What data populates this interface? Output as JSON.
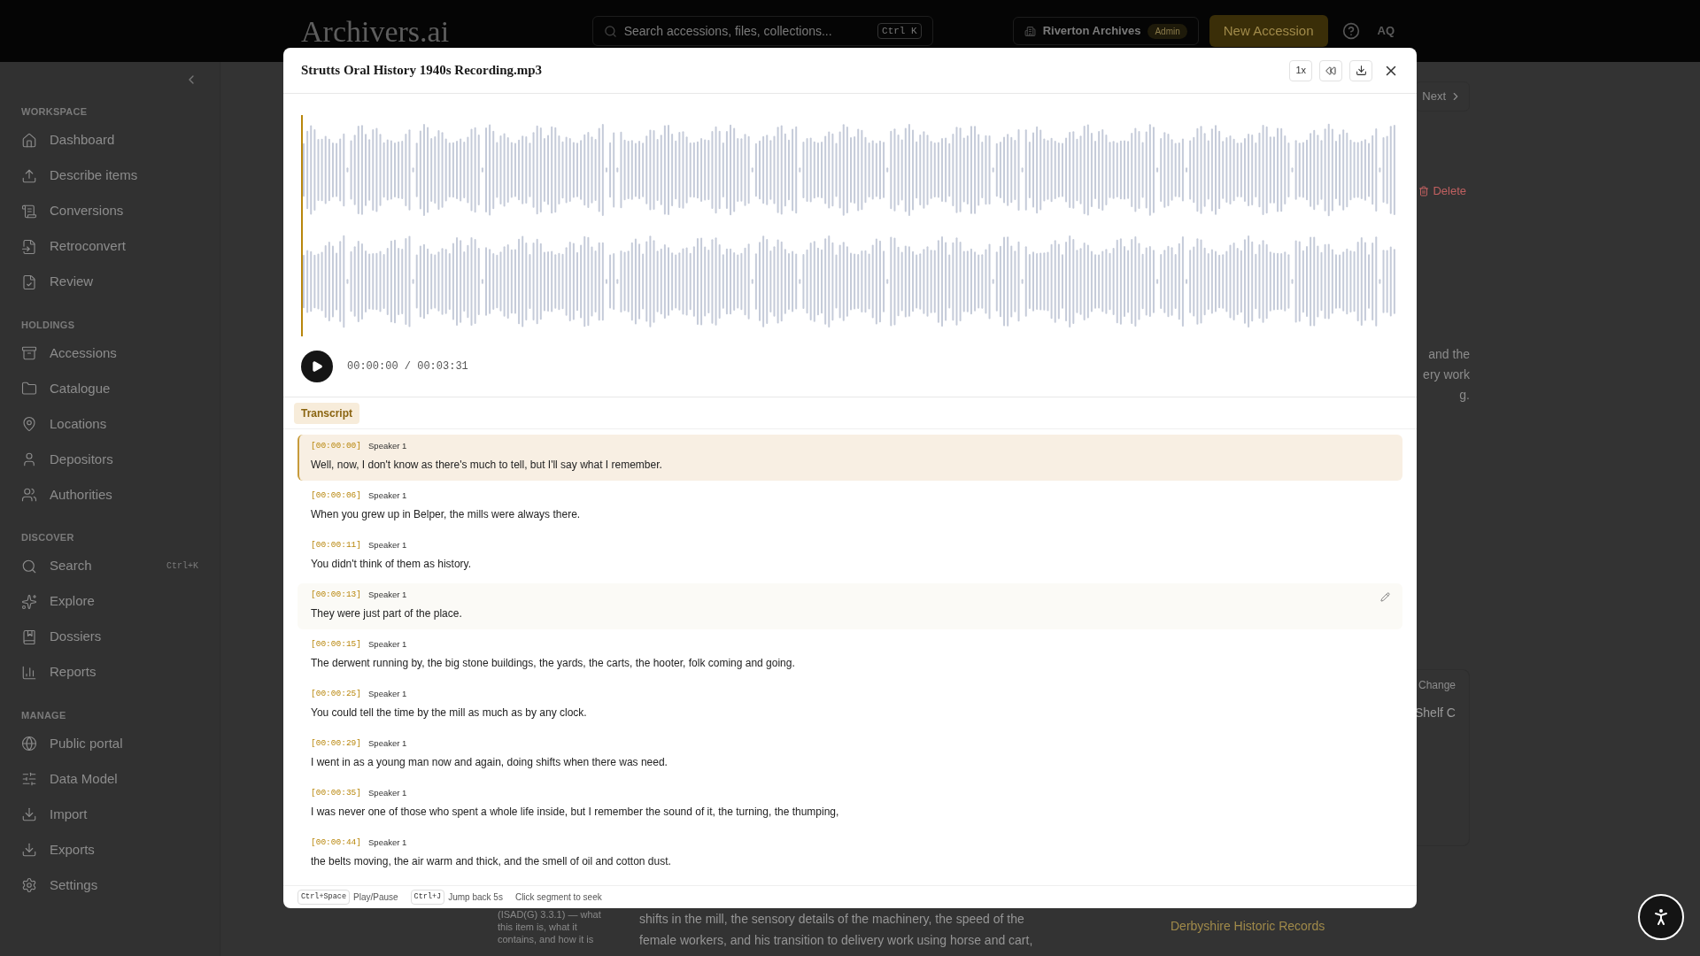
{
  "topbar": {
    "logo": "Archivers.ai",
    "search_placeholder": "Search accessions, files, collections...",
    "search_shortcut": "Ctrl K",
    "workspace": "Riverton Archives",
    "role": "Admin",
    "new_button": "New Accession",
    "avatar": "AQ"
  },
  "sidebar": {
    "sections": [
      {
        "title": "WORKSPACE",
        "items": [
          {
            "label": "Dashboard"
          },
          {
            "label": "Describe items"
          },
          {
            "label": "Conversions"
          },
          {
            "label": "Retroconvert"
          },
          {
            "label": "Review"
          }
        ]
      },
      {
        "title": "HOLDINGS",
        "items": [
          {
            "label": "Accessions"
          },
          {
            "label": "Catalogue"
          },
          {
            "label": "Locations"
          },
          {
            "label": "Depositors"
          },
          {
            "label": "Authorities"
          }
        ]
      },
      {
        "title": "DISCOVER",
        "items": [
          {
            "label": "Search",
            "shortcut": "Ctrl+K"
          },
          {
            "label": "Explore"
          },
          {
            "label": "Dossiers"
          },
          {
            "label": "Reports"
          }
        ]
      },
      {
        "title": "MANAGE",
        "items": [
          {
            "label": "Public portal"
          },
          {
            "label": "Data Model"
          },
          {
            "label": "Import"
          },
          {
            "label": "Exports"
          },
          {
            "label": "Settings"
          }
        ]
      }
    ]
  },
  "background": {
    "next": "Next",
    "delete": "Delete",
    "description_fragments": [
      "and the",
      "ery work",
      "g."
    ],
    "location_action": "Change",
    "location_value": "Shelf C",
    "repository": "Derbyshire Historic Records",
    "guide_lines": [
      "(ISAD(G) 3.3.1) — what",
      "this item is, what it",
      "contains, and how it is"
    ],
    "summary_lines": [
      "shifts in the mill, the sensory details of the machinery, the speed of the",
      "female workers, and his transition to delivery work using horse and cart,"
    ]
  },
  "player": {
    "title": "Strutts Oral History 1940s Recording.mp3",
    "speed": "1x",
    "time": "00:00:00 / 00:03:31",
    "level": 0
  },
  "transcript": {
    "tab": "Transcript",
    "segments": [
      {
        "time": "[00:00:00]",
        "speaker": "Speaker 1",
        "text": "Well, now, I don't know as there's much to tell, but I'll say what I remember.",
        "selected": true,
        "hovered": false
      },
      {
        "time": "[00:00:06]",
        "speaker": "Speaker 1",
        "text": "When you grew up in Belper, the mills were always there.",
        "selected": false,
        "hovered": false
      },
      {
        "time": "[00:00:11]",
        "speaker": "Speaker 1",
        "text": "You didn't think of them as history.",
        "selected": false,
        "hovered": false
      },
      {
        "time": "[00:00:13]",
        "speaker": "Speaker 1",
        "text": "They were just part of the place.",
        "selected": false,
        "hovered": true
      },
      {
        "time": "[00:00:15]",
        "speaker": "Speaker 1",
        "text": "The derwent running by, the big stone buildings, the yards, the carts, the hooter, folk coming and going.",
        "selected": false,
        "hovered": false
      },
      {
        "time": "[00:00:25]",
        "speaker": "Speaker 1",
        "text": "You could tell the time by the mill as much as by any clock.",
        "selected": false,
        "hovered": false
      },
      {
        "time": "[00:00:29]",
        "speaker": "Speaker 1",
        "text": "I went in as a young man now and again, doing shifts when there was need.",
        "selected": false,
        "hovered": false
      },
      {
        "time": "[00:00:35]",
        "speaker": "Speaker 1",
        "text": "I was never one of those who spent a whole life inside, but I remember the sound of it, the turning, the thumping,",
        "selected": false,
        "hovered": false
      },
      {
        "time": "[00:00:44]",
        "speaker": "Speaker 1",
        "text": "the belts moving, the air warm and thick, and the smell of oil and cotton dust.",
        "selected": false,
        "hovered": false
      }
    ]
  },
  "footer": {
    "hints": [
      {
        "key": "Ctrl+Space",
        "label": "Play/Pause"
      },
      {
        "key": "Ctrl+J",
        "label": "Jump back 5s"
      }
    ],
    "note": "Click segment to seek"
  }
}
